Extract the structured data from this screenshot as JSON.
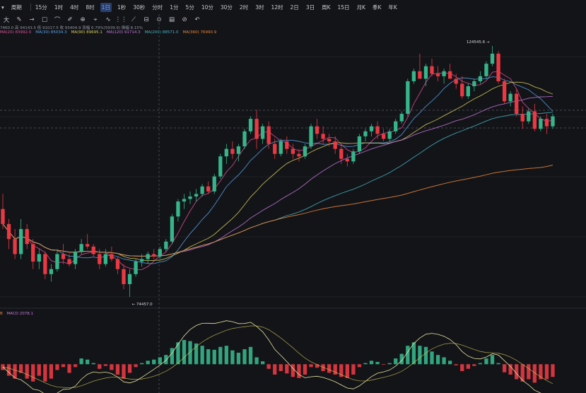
{
  "toolbar": {
    "selector": "▾",
    "period_label": "周期",
    "intervals": [
      "15分",
      "1时",
      "4时",
      "8时",
      "1日",
      "1秒",
      "30秒",
      "分时",
      "1分",
      "5分",
      "10分",
      "30分",
      "2时",
      "3时",
      "12时",
      "2日",
      "3日",
      "周K",
      "15日",
      "月K",
      "季K",
      "年K"
    ],
    "active_interval": "1日"
  },
  "drawing_tools": [
    "大",
    "✎",
    "→",
    "□",
    "⌒",
    "✐",
    "⊕",
    "⌖",
    "∿",
    "⋮⋮",
    "⟋",
    "⊟",
    "⊙",
    "▤",
    "⊘",
    "↶"
  ],
  "ohlc_text": "7460.0 高 94143.5 低 91017.5 收 93404.9 涨幅 6.79%(5939.9) 振幅 8.15%",
  "ma_legend": [
    {
      "text": "MA(20) 83992.0",
      "color": "#e0509c"
    },
    {
      "text": "MA(30) 85034.3",
      "color": "#5aa3e8"
    },
    {
      "text": "MA(90) 89695.1",
      "color": "#d8cf5a"
    },
    {
      "text": "MA(120) 91714.3",
      "color": "#c678dd"
    },
    {
      "text": "MA(200) 88571.0",
      "color": "#45b5c4"
    },
    {
      "text": "MA(360) 76990.9",
      "color": "#e8853a"
    }
  ],
  "macd_legend": {
    "prefix": "B",
    "text": "MACD 2078.1"
  },
  "annotations": {
    "high": "124545.6",
    "low": "74457.0"
  },
  "colors": {
    "up": "#36b58a",
    "down": "#ea3943",
    "background": "#131418"
  },
  "chart_data": {
    "type": "candlestick",
    "price_range": [
      74457.0,
      124545.6
    ],
    "candles": [
      [
        92000,
        95000,
        88000,
        89000
      ],
      [
        89000,
        90000,
        84000,
        86000
      ],
      [
        86000,
        88000,
        82000,
        83000
      ],
      [
        83000,
        90000,
        82000,
        88000
      ],
      [
        88000,
        89000,
        84000,
        85000
      ],
      [
        85000,
        86000,
        80000,
        81500
      ],
      [
        81500,
        84000,
        80000,
        83000
      ],
      [
        83000,
        83500,
        78000,
        79000
      ],
      [
        79000,
        81000,
        77500,
        80000
      ],
      [
        80000,
        84000,
        79500,
        83000
      ],
      [
        83000,
        85000,
        81000,
        82000
      ],
      [
        82000,
        83000,
        80500,
        81000
      ],
      [
        81000,
        84000,
        80000,
        83500
      ],
      [
        83500,
        86000,
        83000,
        85000
      ],
      [
        85000,
        87000,
        84000,
        84500
      ],
      [
        84500,
        85000,
        82500,
        83000
      ],
      [
        83000,
        84000,
        80000,
        81000
      ],
      [
        81000,
        84000,
        80500,
        83000
      ],
      [
        83000,
        84500,
        81500,
        82000
      ],
      [
        82000,
        82500,
        79000,
        80000
      ],
      [
        80000,
        81000,
        76000,
        77000
      ],
      [
        77000,
        80000,
        74457,
        79000
      ],
      [
        79000,
        82000,
        78500,
        81500
      ],
      [
        81500,
        83000,
        80500,
        82000
      ],
      [
        82000,
        83500,
        81000,
        83000
      ],
      [
        83000,
        84000,
        82000,
        82500
      ],
      [
        82500,
        84500,
        82000,
        84000
      ],
      [
        84000,
        86000,
        83500,
        85500
      ],
      [
        85500,
        91000,
        85000,
        90500
      ],
      [
        90500,
        94000,
        89500,
        93500
      ],
      [
        93500,
        95000,
        92000,
        94000
      ],
      [
        94000,
        95500,
        93000,
        94500
      ],
      [
        94500,
        96000,
        93500,
        95000
      ],
      [
        95000,
        97000,
        94500,
        96500
      ],
      [
        96500,
        97500,
        95000,
        95500
      ],
      [
        95500,
        99000,
        95000,
        98500
      ],
      [
        98500,
        103000,
        98000,
        102500
      ],
      [
        102500,
        105000,
        101000,
        104000
      ],
      [
        104000,
        105500,
        102000,
        103000
      ],
      [
        103000,
        105000,
        101500,
        104500
      ],
      [
        104500,
        108000,
        104000,
        107500
      ],
      [
        107500,
        110500,
        107000,
        110000
      ],
      [
        110000,
        111800,
        104000,
        106000
      ],
      [
        106000,
        109000,
        105000,
        108500
      ],
      [
        108500,
        109500,
        104000,
        105000
      ],
      [
        105000,
        106000,
        102000,
        103000
      ],
      [
        103000,
        106000,
        102500,
        105500
      ],
      [
        105500,
        106500,
        103000,
        104000
      ],
      [
        104000,
        105000,
        102000,
        103000
      ],
      [
        103000,
        104000,
        101500,
        102500
      ],
      [
        102500,
        105000,
        102000,
        104500
      ],
      [
        104500,
        109000,
        104000,
        108500
      ],
      [
        108500,
        110000,
        106000,
        107000
      ],
      [
        107000,
        108500,
        105000,
        106000
      ],
      [
        106000,
        107000,
        104500,
        105500
      ],
      [
        105500,
        106500,
        103000,
        104000
      ],
      [
        104000,
        105000,
        101000,
        102000
      ],
      [
        102000,
        103000,
        100500,
        101500
      ],
      [
        101500,
        104000,
        101000,
        103500
      ],
      [
        103500,
        107000,
        103000,
        106500
      ],
      [
        106500,
        108000,
        105500,
        107500
      ],
      [
        107500,
        109000,
        106500,
        108500
      ],
      [
        108500,
        109500,
        106000,
        107000
      ],
      [
        107000,
        108000,
        105500,
        106000
      ],
      [
        106000,
        108000,
        105500,
        107500
      ],
      [
        107500,
        110000,
        107000,
        109500
      ],
      [
        109500,
        111500,
        109000,
        111000
      ],
      [
        111000,
        118000,
        110500,
        117500
      ],
      [
        117500,
        120000,
        117000,
        119500
      ],
      [
        119500,
        123000,
        118500,
        118000
      ],
      [
        118000,
        121000,
        116500,
        120500
      ],
      [
        120500,
        122000,
        118500,
        119000
      ],
      [
        119000,
        120500,
        117500,
        118500
      ],
      [
        118500,
        120000,
        117000,
        119500
      ],
      [
        119500,
        121000,
        118000,
        118000
      ],
      [
        118000,
        119000,
        116000,
        117000
      ],
      [
        117000,
        118500,
        114000,
        114500
      ],
      [
        114500,
        117000,
        114000,
        116500
      ],
      [
        116500,
        118000,
        115500,
        117500
      ],
      [
        117500,
        119500,
        117000,
        118500
      ],
      [
        118500,
        121500,
        118000,
        121000
      ],
      [
        121000,
        124545.6,
        120500,
        123000
      ],
      [
        123000,
        123500,
        117000,
        117500
      ],
      [
        117500,
        118000,
        113000,
        113500
      ],
      [
        113500,
        115500,
        112500,
        115000
      ],
      [
        115000,
        116000,
        110500,
        111000
      ],
      [
        111000,
        112500,
        108000,
        109500
      ],
      [
        109500,
        112000,
        109000,
        111500
      ],
      [
        111500,
        113000,
        107500,
        108000
      ],
      [
        108000,
        110500,
        107500,
        110000
      ],
      [
        110000,
        111000,
        107000,
        108500
      ],
      [
        108500,
        111000,
        108000,
        110500
      ]
    ],
    "macd": {
      "histogram": [
        -1,
        -2,
        -2.5,
        -1.5,
        -2.5,
        -3,
        -2,
        -3,
        -2.5,
        -1,
        -0.5,
        -1.5,
        -0.5,
        1,
        0.8,
        0.2,
        -0.8,
        -0.3,
        -1,
        -1.8,
        -2.5,
        -1.5,
        -0.5,
        0.2,
        0.6,
        0.8,
        1.2,
        1.6,
        2.8,
        3.8,
        4.2,
        4.0,
        3.6,
        3.2,
        2.6,
        2.5,
        3.0,
        3.2,
        2.4,
        2.0,
        2.6,
        3.0,
        1.2,
        0.5,
        -0.8,
        -1.8,
        -1.2,
        -1.6,
        -2.2,
        -2.4,
        -1.8,
        -0.5,
        -0.6,
        -1.2,
        -1.5,
        -1.8,
        -2.2,
        -2.4,
        -1.8,
        -0.5,
        0.2,
        0.6,
        0.4,
        -0.1,
        0.2,
        1.0,
        1.8,
        3.2,
        3.8,
        3.2,
        3.0,
        2.2,
        1.6,
        1.2,
        0.6,
        -0.2,
        -1.2,
        -0.8,
        -0.3,
        0.2,
        1.0,
        1.6,
        0.2,
        -1.4,
        -1.8,
        -2.6,
        -3.0,
        -2.6,
        -3.2,
        -2.6,
        -2.6,
        -2.2
      ],
      "range": [
        -4.5,
        8
      ]
    }
  }
}
